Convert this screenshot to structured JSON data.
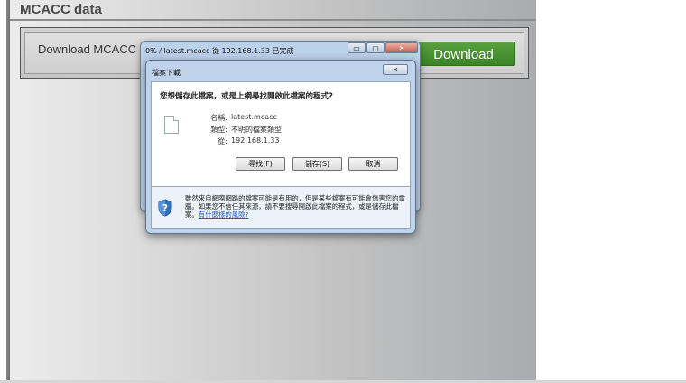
{
  "page": {
    "section_title": "MCACC data",
    "download_label": "Download MCACC data",
    "download_button": "Download"
  },
  "progress_window": {
    "title": "0% / latest.mcacc 從 192.168.1.33 已完成",
    "controls": [
      "▭",
      "▢",
      "✕"
    ]
  },
  "save_dialog": {
    "title": "檔案下載",
    "close_label": "✕",
    "question": "您想儲存此檔案，或是上網尋找開啟此檔案的程式?",
    "fields": [
      {
        "key": "名稱:",
        "value": "latest.mcacc"
      },
      {
        "key": "類型:",
        "value": "不明的檔案類型"
      },
      {
        "key": "從:",
        "value": "192.168.1.33"
      }
    ],
    "buttons": {
      "find": "尋找(F)",
      "save": "儲存(S)",
      "cancel": "取消"
    },
    "warning_text": "雖然來自網際網路的檔案可能是有用的，但是某些檔案有可能會傷害您的電腦。如果您不信任其來源，請不要搜尋開啟此檔案的程式，或是儲存此檔案。",
    "warning_link": "有什麼樣的風險?"
  },
  "colors": {
    "download_button": "#3b8327",
    "dialog_frame": "#bfd4ec",
    "link": "#1a5bd0"
  }
}
